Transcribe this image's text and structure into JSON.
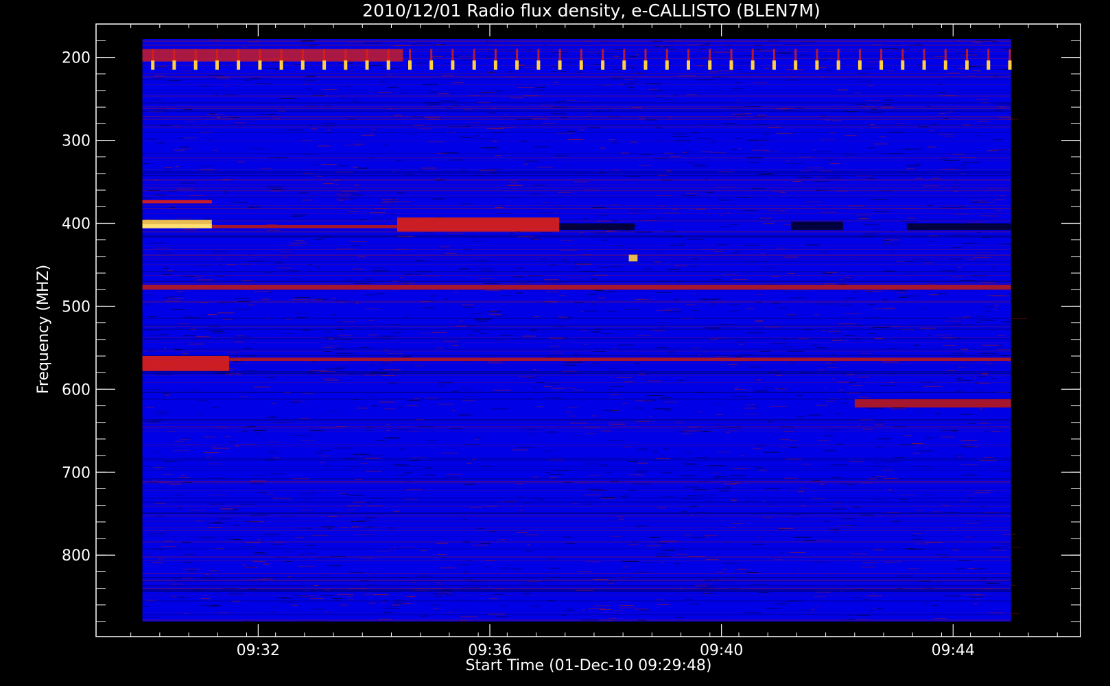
{
  "chart_data": {
    "type": "heatmap",
    "title": "2010/12/01  Radio flux density, e-CALLISTO (BLEN7M)",
    "xlabel": "Start Time (01-Dec-10 09:29:48)",
    "ylabel": "Frequency (MHZ)",
    "x_ticks": [
      "09:32",
      "09:36",
      "09:40",
      "09:44"
    ],
    "x_tick_values_min": [
      2.2,
      6.2,
      10.2,
      14.2
    ],
    "xlim_min": [
      -0.6,
      16.4
    ],
    "data_xlim_min": [
      0.2,
      15.2
    ],
    "y_ticks": [
      "200",
      "300",
      "400",
      "500",
      "600",
      "700",
      "800"
    ],
    "y_tick_values": [
      200,
      300,
      400,
      500,
      600,
      700,
      800
    ],
    "ylim": [
      178,
      880
    ],
    "y_inverted": true,
    "colors": {
      "background": "#0000e6",
      "noise_dark": "#000020",
      "noise_red": "#a01818",
      "band_red": "#e02010",
      "band_hot": "#ffd040",
      "frame": "#ffffff"
    },
    "features": [
      {
        "label": "",
        "freq_mhz": [
          190,
          215
        ],
        "time_min": [
          0.2,
          15.2
        ],
        "intensity": "high",
        "kind": "periodic-bursts"
      },
      {
        "label": "",
        "freq_mhz": [
          372,
          376
        ],
        "time_min": [
          0.2,
          1.4
        ],
        "intensity": "high",
        "kind": "band"
      },
      {
        "label": "",
        "freq_mhz": [
          396,
          406
        ],
        "time_min": [
          0.2,
          1.4
        ],
        "intensity": "very-high",
        "kind": "band"
      },
      {
        "label": "",
        "freq_mhz": [
          402,
          406
        ],
        "time_min": [
          1.4,
          4.6
        ],
        "intensity": "medium",
        "kind": "band"
      },
      {
        "label": "",
        "freq_mhz": [
          393,
          410
        ],
        "time_min": [
          4.6,
          7.4
        ],
        "intensity": "high",
        "kind": "band"
      },
      {
        "label": "",
        "freq_mhz": [
          400,
          408
        ],
        "time_min": [
          7.4,
          8.7
        ],
        "intensity": "dark",
        "kind": "band"
      },
      {
        "label": "",
        "freq_mhz": [
          398,
          408
        ],
        "time_min": [
          11.4,
          12.3
        ],
        "intensity": "dark",
        "kind": "band"
      },
      {
        "label": "",
        "freq_mhz": [
          400,
          408
        ],
        "time_min": [
          13.4,
          15.2
        ],
        "intensity": "dark",
        "kind": "band"
      },
      {
        "label": "",
        "freq_mhz": [
          474,
          480
        ],
        "time_min": [
          0.2,
          15.2
        ],
        "intensity": "medium",
        "kind": "band"
      },
      {
        "label": "",
        "freq_mhz": [
          560,
          578
        ],
        "time_min": [
          0.2,
          1.7
        ],
        "intensity": "high",
        "kind": "band"
      },
      {
        "label": "",
        "freq_mhz": [
          562,
          566
        ],
        "time_min": [
          1.7,
          15.2
        ],
        "intensity": "medium",
        "kind": "band"
      },
      {
        "label": "",
        "freq_mhz": [
          612,
          622
        ],
        "time_min": [
          12.5,
          15.2
        ],
        "intensity": "medium",
        "kind": "band"
      },
      {
        "label": "",
        "freq_mhz": [
          438,
          446
        ],
        "time_min": [
          8.6,
          8.75
        ],
        "intensity": "very-high",
        "kind": "spot"
      }
    ]
  }
}
